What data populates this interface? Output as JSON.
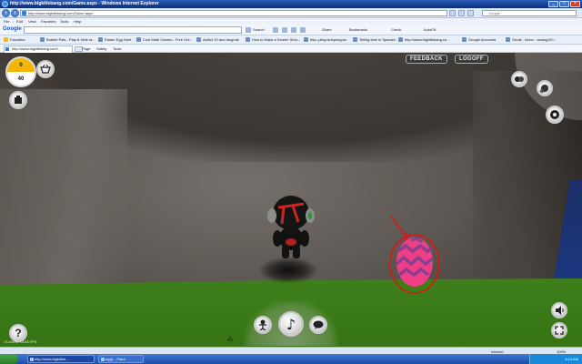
{
  "window": {
    "title": "http://www.bigkitlebang.com/Game.aspx - Windows Internet Explorer",
    "buttons": [
      "_",
      "□",
      "×"
    ]
  },
  "address_bar": {
    "url": "http://www.bigkitlebang.com/Game.aspx",
    "search_placeholder": "Google"
  },
  "menu": {
    "items": [
      "File",
      "Edit",
      "View",
      "Favorites",
      "Tools",
      "Help"
    ]
  },
  "google_toolbar": {
    "logo": "Google",
    "search_label": "Search",
    "share_label": "Share",
    "bookmarks_label": "Bookmarks",
    "check_label": "Check",
    "autofill_label": "AutoFill"
  },
  "favorites": {
    "label": "Favorites",
    "items": [
      "Bubble Pals - Play & Hide et...",
      "Easter Egg Hunt",
      "Cool Math Games - Free Onl...",
      "Addict 20 and tangrole",
      "How to Make a Screen Shot...",
      "http--pilay.clubpenguin",
      "Telling time in Spanish",
      "http://www.bigkitlebang.co...",
      "Google Accounts",
      "Gmail - Inbox - claasg100..."
    ]
  },
  "command_bar": {
    "tab_label": "http://www.bigkitlebang.com/...",
    "page_label": "Page",
    "safety_label": "Safety",
    "tools_label": "Tools"
  },
  "game": {
    "coins_top": "0",
    "coins_bottom": "40",
    "feedback_label": "FEEDBACK",
    "logoff_label": "LOGOFF",
    "help_label": "?",
    "stats_text": "73.40ms, 13.63 FPS",
    "map_mark": "⁂"
  },
  "status_bar": {
    "zone": "Internet",
    "zoom": "100%"
  },
  "taskbar": {
    "tasks": [
      "http://www.bigkitleb...",
      "egg1 - Paint"
    ],
    "clock": "8:14 AM"
  },
  "colors": {
    "egg_base": "#ee3f86",
    "egg_stripe": "#8a3f8f",
    "annotation": "#e01414",
    "grass": "#3a7a17",
    "coin_yellow": "#f2b705"
  }
}
